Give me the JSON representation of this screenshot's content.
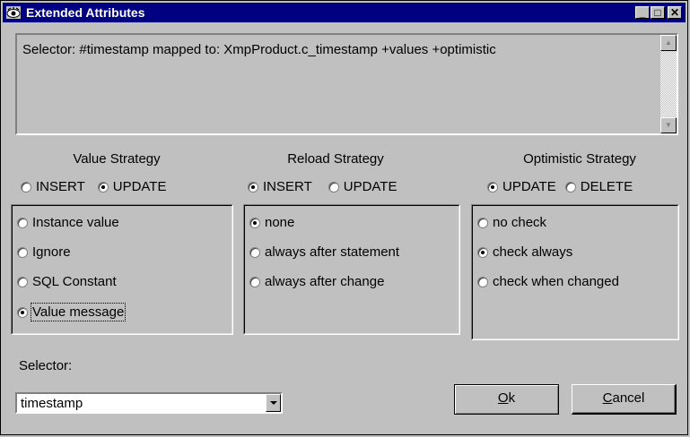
{
  "window": {
    "title": "Extended Attributes",
    "min_glyph": "_",
    "max_glyph": "□",
    "close_glyph": "✕"
  },
  "description": "Selector: #timestamp mapped to: XmpProduct.c_timestamp +values +optimistic",
  "value_strategy": {
    "title": "Value Strategy",
    "modes": [
      {
        "label": "INSERT",
        "checked": false
      },
      {
        "label": "UPDATE",
        "checked": true
      }
    ],
    "options": [
      {
        "label": "Instance value",
        "checked": false
      },
      {
        "label": "Ignore",
        "checked": false
      },
      {
        "label": "SQL Constant",
        "checked": false
      },
      {
        "label": "Value message",
        "checked": true
      }
    ]
  },
  "reload_strategy": {
    "title": "Reload Strategy",
    "modes": [
      {
        "label": "INSERT",
        "checked": true
      },
      {
        "label": "UPDATE",
        "checked": false
      }
    ],
    "options": [
      {
        "label": "none",
        "checked": true
      },
      {
        "label": "always after statement",
        "checked": false
      },
      {
        "label": "always after change",
        "checked": false
      }
    ]
  },
  "optimistic_strategy": {
    "title": "Optimistic Strategy",
    "modes": [
      {
        "label": "UPDATE",
        "checked": true
      },
      {
        "label": "DELETE",
        "checked": false
      }
    ],
    "options": [
      {
        "label": "no check",
        "checked": false
      },
      {
        "label": "check always",
        "checked": true
      },
      {
        "label": "check when changed",
        "checked": false
      }
    ]
  },
  "selector": {
    "label": "Selector:",
    "value": "timestamp"
  },
  "buttons": {
    "ok_mnemonic": "O",
    "ok_rest": "k",
    "cancel_mnemonic": "C",
    "cancel_rest": "ancel"
  }
}
